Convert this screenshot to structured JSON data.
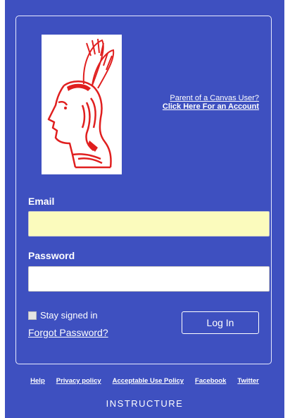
{
  "brand_colors": {
    "background": "#3e50c0",
    "logo_red": "#e01f1f",
    "email_input_bg": "#fbfbbd"
  },
  "logo": {
    "icon": "chief-head-logo"
  },
  "parent_link": {
    "line1": "Parent of a Canvas User?",
    "line2": "Click Here For an Account"
  },
  "form": {
    "email_label": "Email",
    "email_value": "",
    "password_label": "Password",
    "password_value": "",
    "stay_signed_in": "Stay signed in",
    "forgot_password": "Forgot Password?",
    "login_button": "Log In"
  },
  "footer": {
    "links": [
      "Help",
      "Privacy policy",
      "Acceptable Use Policy",
      "Facebook",
      "Twitter"
    ],
    "brand": "INSTRUCTURE"
  }
}
